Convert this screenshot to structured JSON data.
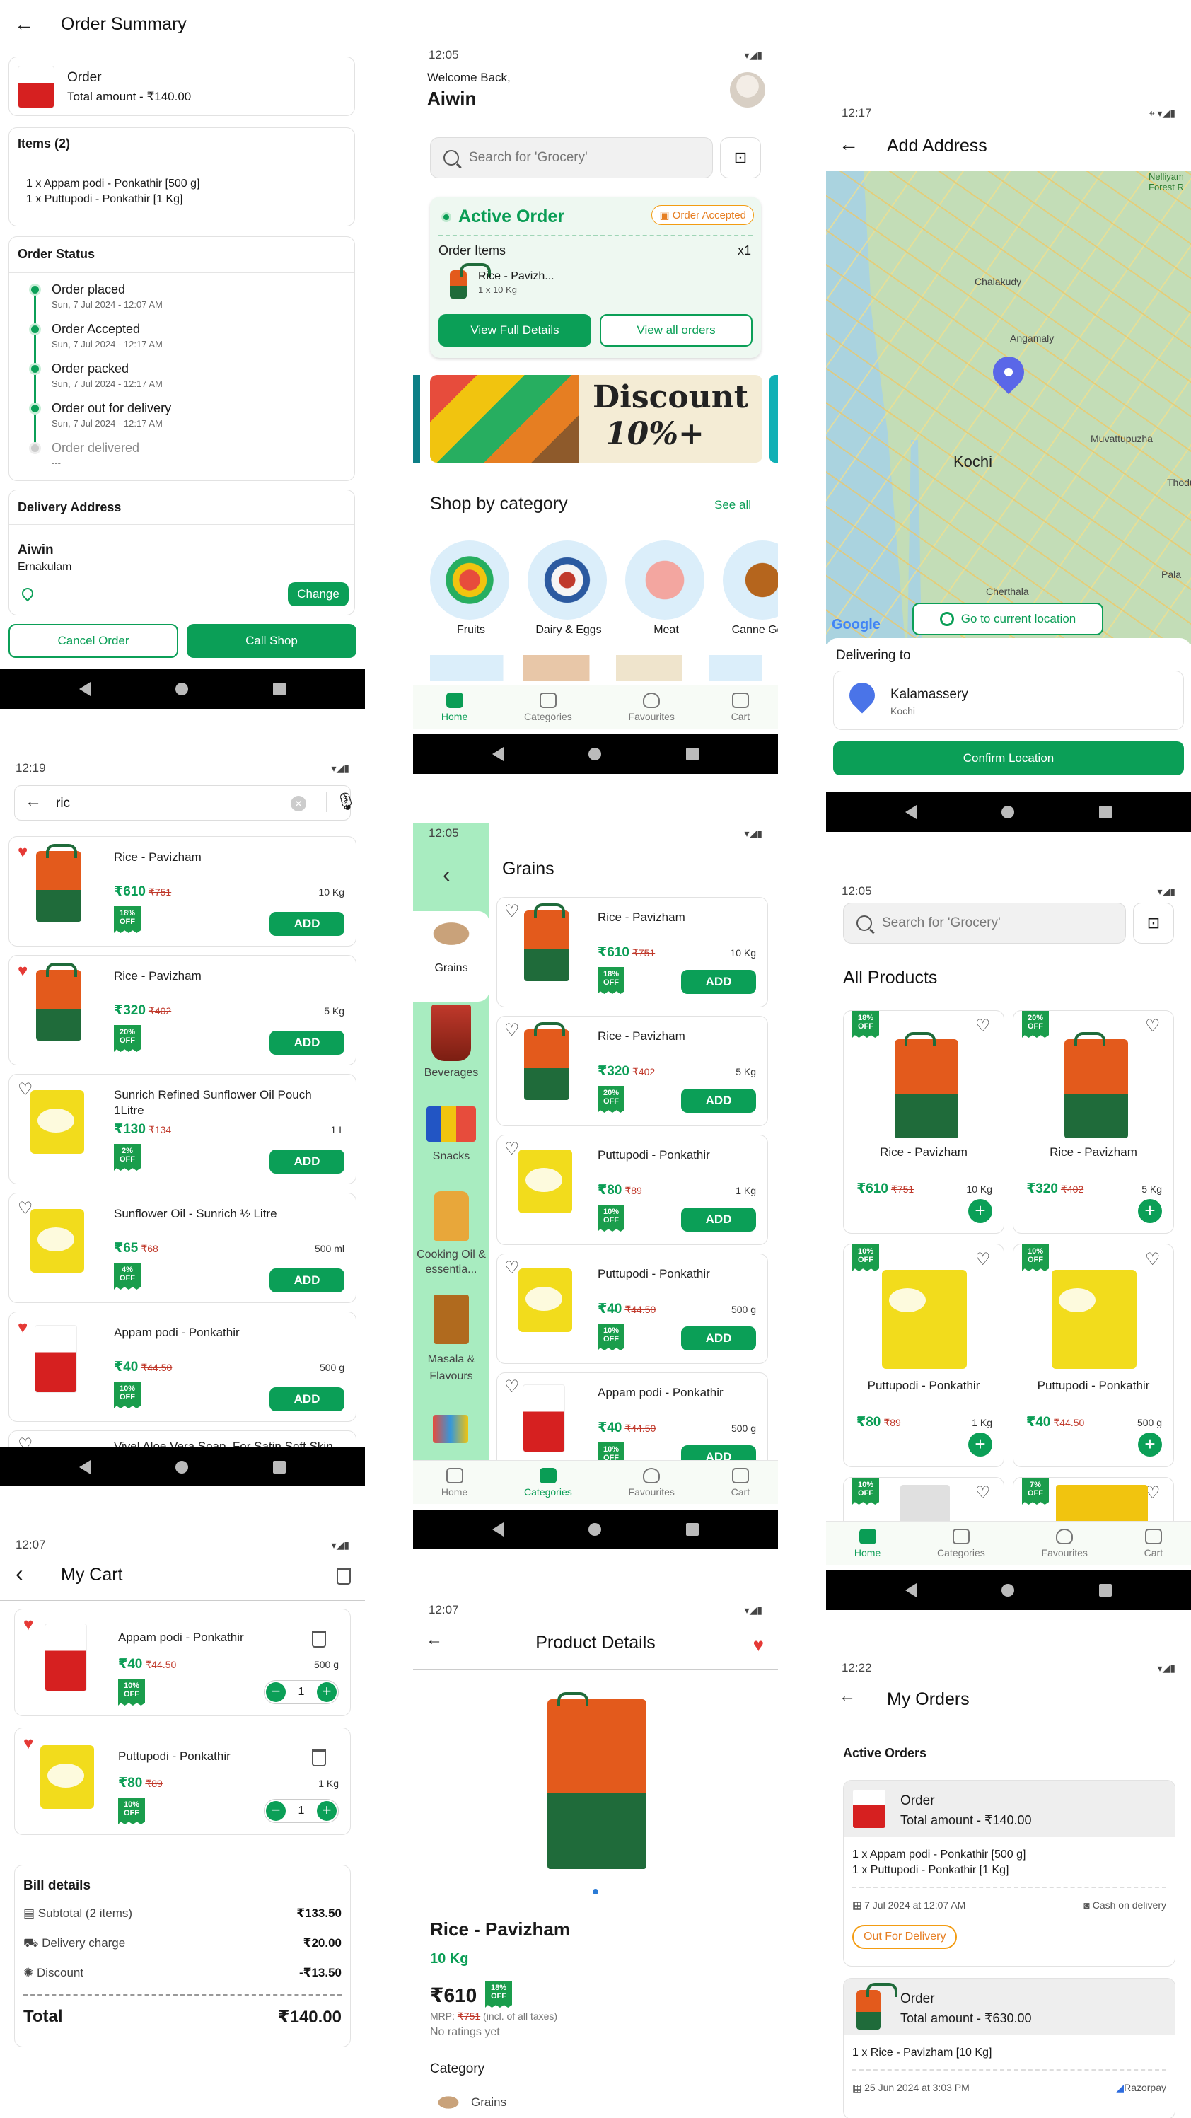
{
  "order_summary": {
    "title": "Order Summary",
    "order_label": "Order",
    "total_amount": "Total amount - ₹140.00",
    "items_heading": "Items (2)",
    "items": [
      "1 x Appam podi - Ponkathir  [500 g]",
      "1 x Puttupodi - Ponkathir [1 Kg]"
    ],
    "status_heading": "Order Status",
    "status_steps": [
      {
        "label": "Order placed",
        "time": "Sun, 7 Jul 2024 - 12:07 AM"
      },
      {
        "label": "Order Accepted",
        "time": "Sun, 7 Jul 2024 - 12:17 AM"
      },
      {
        "label": "Order packed",
        "time": "Sun, 7 Jul 2024 - 12:17 AM"
      },
      {
        "label": "Order out for delivery",
        "time": "Sun, 7 Jul 2024 - 12:17 AM"
      },
      {
        "label": "Order delivered",
        "time": "---"
      }
    ],
    "address_heading": "Delivery Address",
    "address_name": "Aiwin",
    "address_city": "Ernakulam",
    "change_label": "Change",
    "cancel_label": "Cancel Order",
    "call_label": "Call Shop"
  },
  "home": {
    "time": "12:05",
    "welcome": "Welcome Back,",
    "user": "Aiwin",
    "search_placeholder": "Search for 'Grocery'",
    "active_order_title": "Active Order",
    "order_badge": "Order Accepted",
    "order_items_label": "Order Items",
    "order_items_count": "x1",
    "order_item_name": "Rice - Pavizh...",
    "order_item_qty": "1 x 10 Kg",
    "view_details": "View Full Details",
    "view_all": "View all orders",
    "banner_line1": "Discount",
    "banner_line2": "10%+",
    "category_heading": "Shop by category",
    "see_all": "See all",
    "categories": [
      "Fruits",
      "Dairy & Eggs",
      "Meat",
      "Canne Good"
    ]
  },
  "add_address": {
    "time": "12:17",
    "title": "Add Address",
    "map_labels": [
      "Chalakudy",
      "Angamaly",
      "Kochi",
      "Muvattupuzha",
      "Cherthala",
      "Pala",
      "Thodu",
      "Nelliyam Forest R"
    ],
    "go_current": "Go to current location",
    "google": "Google",
    "delivering_to": "Delivering to",
    "place": "Kalamassery",
    "place_sub": "Kochi",
    "confirm": "Confirm Location"
  },
  "search": {
    "time": "12:19",
    "query": "ric",
    "results": [
      {
        "name": "Rice - Pavizham",
        "price": "₹610",
        "mrp": "₹751",
        "qty": "10 Kg",
        "off": "18% OFF",
        "fav": true
      },
      {
        "name": "Rice - Pavizham",
        "price": "₹320",
        "mrp": "₹402",
        "qty": "5 Kg",
        "off": "20% OFF",
        "fav": true
      },
      {
        "name": "Sunrich Refined Sunflower Oil Pouch 1Litre",
        "price": "₹130",
        "mrp": "₹134",
        "qty": "1 L",
        "off": "2% OFF",
        "fav": false
      },
      {
        "name": "Sunflower Oil - Sunrich ½ Litre",
        "price": "₹65",
        "mrp": "₹68",
        "qty": "500 ml",
        "off": "4% OFF",
        "fav": false
      },
      {
        "name": "Appam podi - Ponkathir",
        "price": "₹40",
        "mrp": "₹44.50",
        "qty": "500 g",
        "off": "10% OFF",
        "fav": true
      }
    ],
    "partial_item": "Vivel Aloe Vera Soap, For Satin Soft Skin",
    "add_label": "ADD"
  },
  "grains": {
    "time": "12:05",
    "title": "Grains",
    "sidebar": [
      "Grains",
      "Beverages",
      "Snacks",
      "Cooking Oil & essentia...",
      "Masala & Flavours"
    ],
    "products": [
      {
        "name": "Rice - Pavizham",
        "price": "₹610",
        "mrp": "₹751",
        "qty": "10 Kg",
        "off": "18% OFF"
      },
      {
        "name": "Rice - Pavizham",
        "price": "₹320",
        "mrp": "₹402",
        "qty": "5 Kg",
        "off": "20% OFF"
      },
      {
        "name": "Puttupodi - Ponkathir",
        "price": "₹80",
        "mrp": "₹89",
        "qty": "1 Kg",
        "off": "10% OFF"
      },
      {
        "name": "Puttupodi - Ponkathir",
        "price": "₹40",
        "mrp": "₹44.50",
        "qty": "500 g",
        "off": "10% OFF"
      },
      {
        "name": "Appam podi - Ponkathir",
        "price": "₹40",
        "mrp": "₹44.50",
        "qty": "500 g",
        "off": "10% OFF"
      }
    ]
  },
  "all_products": {
    "time": "12:05",
    "search_placeholder": "Search for 'Grocery'",
    "title": "All Products",
    "products": [
      {
        "name": "Rice - Pavizham",
        "price": "₹610",
        "mrp": "₹751",
        "qty": "10 Kg",
        "off": "18% OFF"
      },
      {
        "name": "Rice - Pavizham",
        "price": "₹320",
        "mrp": "₹402",
        "qty": "5 Kg",
        "off": "20% OFF"
      },
      {
        "name": "Puttupodi - Ponkathir",
        "price": "₹80",
        "mrp": "₹89",
        "qty": "1 Kg",
        "off": "10% OFF"
      },
      {
        "name": "Puttupodi - Ponkathir",
        "price": "₹40",
        "mrp": "₹44.50",
        "qty": "500 g",
        "off": "10% OFF"
      }
    ],
    "partial_offs": [
      "10% OFF",
      "7% OFF"
    ]
  },
  "tabs": [
    "Home",
    "Categories",
    "Favourites",
    "Cart"
  ],
  "cart": {
    "time": "12:07",
    "title": "My Cart",
    "items": [
      {
        "name": "Appam podi - Ponkathir",
        "price": "₹40",
        "mrp": "₹44.50",
        "qty": "500 g",
        "off": "10% OFF",
        "count": "1"
      },
      {
        "name": "Puttupodi - Ponkathir",
        "price": "₹80",
        "mrp": "₹89",
        "qty": "1 Kg",
        "off": "10% OFF",
        "count": "1"
      }
    ],
    "bill_heading": "Bill details",
    "subtotal_label": "Subtotal (2 items)",
    "subtotal": "₹133.50",
    "delivery_label": "Delivery charge",
    "delivery": "₹20.00",
    "discount_label": "Discount",
    "discount": "-₹13.50",
    "total_label": "Total",
    "total": "₹140.00"
  },
  "product_details": {
    "time": "12:07",
    "title": "Product Details",
    "name": "Rice - Pavizham",
    "qty": "10 Kg",
    "price": "₹610",
    "off": "18% OFF",
    "mrp_prefix": "MRP:",
    "mrp": "₹751",
    "mrp_suffix": "(incl. of all taxes)",
    "ratings": "No ratings yet",
    "category_heading": "Category",
    "category": "Grains"
  },
  "my_orders": {
    "time": "12:22",
    "title": "My Orders",
    "section": "Active Orders",
    "orders": [
      {
        "label": "Order",
        "total": "Total amount - ₹140.00",
        "items": [
          "1 x Appam podi - Ponkathir  [500 g]",
          "1 x Puttupodi - Ponkathir [1 Kg]"
        ],
        "date": "7 Jul 2024 at 12:07 AM",
        "payment": "Cash on delivery",
        "status": "Out For Delivery"
      },
      {
        "label": "Order",
        "total": "Total amount - ₹630.00",
        "items": [
          "1 x Rice - Pavizham [10 Kg]"
        ],
        "date": "25 Jun 2024 at 3:03 PM",
        "payment": "Razorpay"
      }
    ]
  },
  "colors": {
    "accent": "#0b9f57",
    "strike": "#c0392b",
    "badge_orange": "#f39c12"
  }
}
